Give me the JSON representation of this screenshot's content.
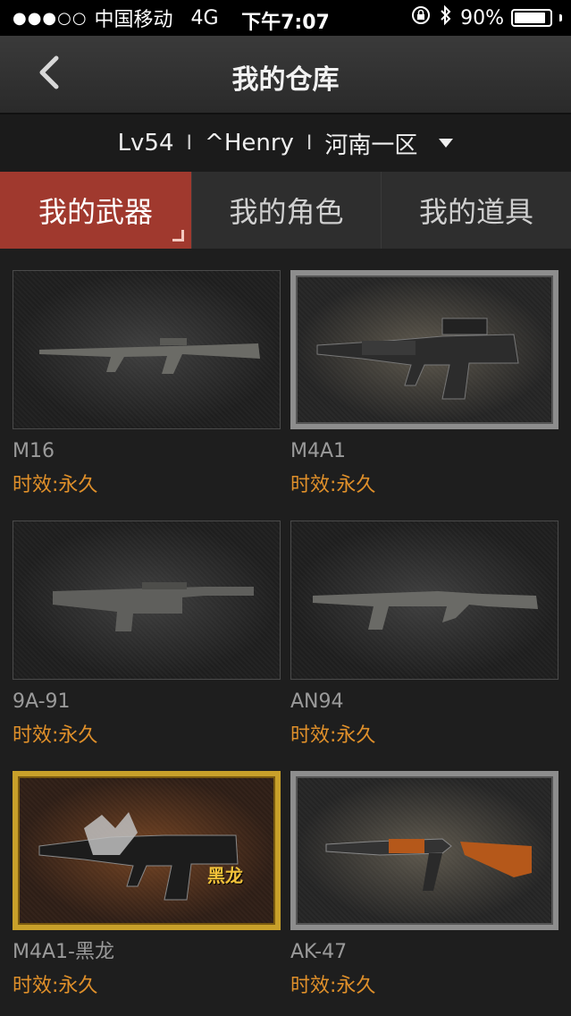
{
  "status_bar": {
    "signal": "●●●○○",
    "carrier": "中国移动",
    "network": "4G",
    "time": "下午7:07",
    "battery_text": "90%",
    "battery_level": 0.9
  },
  "nav": {
    "title": "我的仓库"
  },
  "account": {
    "level": "Lv54",
    "name": "^Henry",
    "server": "河南一区",
    "separator": "I"
  },
  "tabs": [
    {
      "label": "我的武器",
      "active": true
    },
    {
      "label": "我的角色",
      "active": false
    },
    {
      "label": "我的道具",
      "active": false
    }
  ],
  "weapons": [
    {
      "name": "M16",
      "duration": "时效:永久",
      "frame": "plain",
      "icon": "rifle-icon"
    },
    {
      "name": "M4A1",
      "duration": "时效:永久",
      "frame": "framed",
      "icon": "rifle-icon"
    },
    {
      "name": "9A-91",
      "duration": "时效:永久",
      "frame": "plain",
      "icon": "rifle-icon"
    },
    {
      "name": "AN94",
      "duration": "时效:永久",
      "frame": "plain",
      "icon": "rifle-icon"
    },
    {
      "name": "M4A1-黑龙",
      "duration": "时效:永久",
      "frame": "gold",
      "icon": "rifle-icon",
      "badge": "黑龙"
    },
    {
      "name": "AK-47",
      "duration": "时效:永久",
      "frame": "framed",
      "icon": "rifle-icon"
    }
  ],
  "colors": {
    "active_tab": "#a0392e",
    "duration_text": "#e0902a"
  }
}
